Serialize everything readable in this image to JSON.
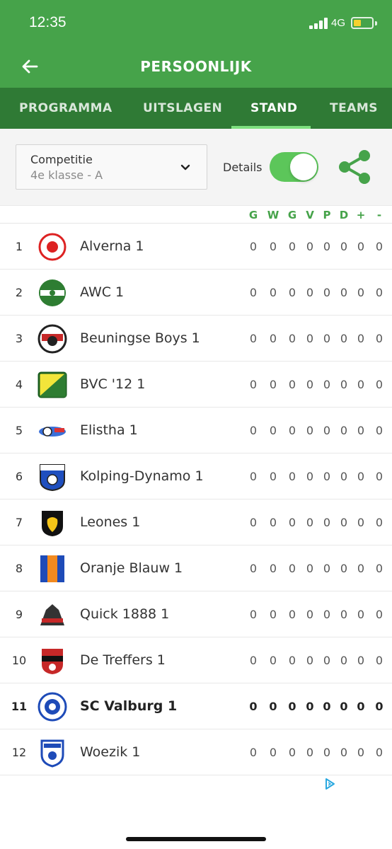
{
  "status_bar": {
    "time": "12:35",
    "network": "4G"
  },
  "header": {
    "title": "PERSOONLIJK",
    "back_icon": "arrow-left-icon"
  },
  "tabs": [
    {
      "label": "PROGRAMMA",
      "active": false
    },
    {
      "label": "UITSLAGEN",
      "active": false
    },
    {
      "label": "STAND",
      "active": true
    },
    {
      "label": "TEAMS",
      "active": false
    }
  ],
  "filter": {
    "select_label": "Competitie",
    "select_value": "4e klasse - A",
    "details_label": "Details",
    "details_on": true,
    "share_icon": "share-icon"
  },
  "columns": [
    "G",
    "W",
    "G",
    "V",
    "P",
    "D",
    "+",
    "-"
  ],
  "standings": [
    {
      "rank": "1",
      "team": "Alverna 1",
      "stats": [
        "0",
        "0",
        "0",
        "0",
        "0",
        "0",
        "0",
        "0"
      ],
      "highlight": false
    },
    {
      "rank": "2",
      "team": "AWC 1",
      "stats": [
        "0",
        "0",
        "0",
        "0",
        "0",
        "0",
        "0",
        "0"
      ],
      "highlight": false
    },
    {
      "rank": "3",
      "team": "Beuningse Boys 1",
      "stats": [
        "0",
        "0",
        "0",
        "0",
        "0",
        "0",
        "0",
        "0"
      ],
      "highlight": false
    },
    {
      "rank": "4",
      "team": "BVC '12 1",
      "stats": [
        "0",
        "0",
        "0",
        "0",
        "0",
        "0",
        "0",
        "0"
      ],
      "highlight": false
    },
    {
      "rank": "5",
      "team": "Elistha 1",
      "stats": [
        "0",
        "0",
        "0",
        "0",
        "0",
        "0",
        "0",
        "0"
      ],
      "highlight": false
    },
    {
      "rank": "6",
      "team": "Kolping-Dynamo 1",
      "stats": [
        "0",
        "0",
        "0",
        "0",
        "0",
        "0",
        "0",
        "0"
      ],
      "highlight": false
    },
    {
      "rank": "7",
      "team": "Leones 1",
      "stats": [
        "0",
        "0",
        "0",
        "0",
        "0",
        "0",
        "0",
        "0"
      ],
      "highlight": false
    },
    {
      "rank": "8",
      "team": "Oranje Blauw 1",
      "stats": [
        "0",
        "0",
        "0",
        "0",
        "0",
        "0",
        "0",
        "0"
      ],
      "highlight": false
    },
    {
      "rank": "9",
      "team": "Quick 1888 1",
      "stats": [
        "0",
        "0",
        "0",
        "0",
        "0",
        "0",
        "0",
        "0"
      ],
      "highlight": false
    },
    {
      "rank": "10",
      "team": "De Treffers 1",
      "stats": [
        "0",
        "0",
        "0",
        "0",
        "0",
        "0",
        "0",
        "0"
      ],
      "highlight": false
    },
    {
      "rank": "11",
      "team": "SC Valburg 1",
      "stats": [
        "0",
        "0",
        "0",
        "0",
        "0",
        "0",
        "0",
        "0"
      ],
      "highlight": true
    },
    {
      "rank": "12",
      "team": "Woezik 1",
      "stats": [
        "0",
        "0",
        "0",
        "0",
        "0",
        "0",
        "0",
        "0"
      ],
      "highlight": false
    }
  ],
  "colors": {
    "header": "#46a34a",
    "tab_bar": "#2f7a35",
    "accent": "#5cc65a",
    "tab_indicator": "#7ee07f"
  },
  "ad_icon": "adchoices-icon"
}
